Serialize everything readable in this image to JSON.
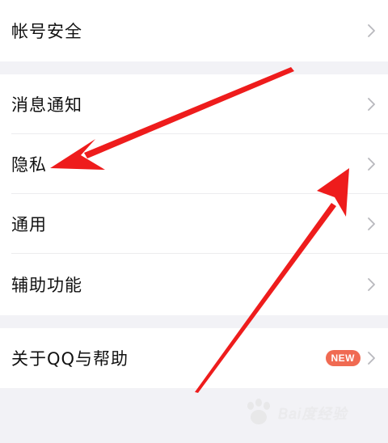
{
  "settings": {
    "account_security": "帐号安全",
    "notifications": "消息通知",
    "privacy": "隐私",
    "general": "通用",
    "accessibility": "辅助功能",
    "about": "关于QQ与帮助",
    "about_badge": "NEW"
  },
  "colors": {
    "background": "#f2f2f6",
    "badge": "#f06a52",
    "arrow": "#ee1c1c"
  },
  "icons": {
    "chevron": "chevron-right-icon",
    "annotation_arrow": "red-arrow",
    "watermark": "baidu-paw-logo"
  },
  "watermark": {
    "text": "Bai度经验"
  }
}
